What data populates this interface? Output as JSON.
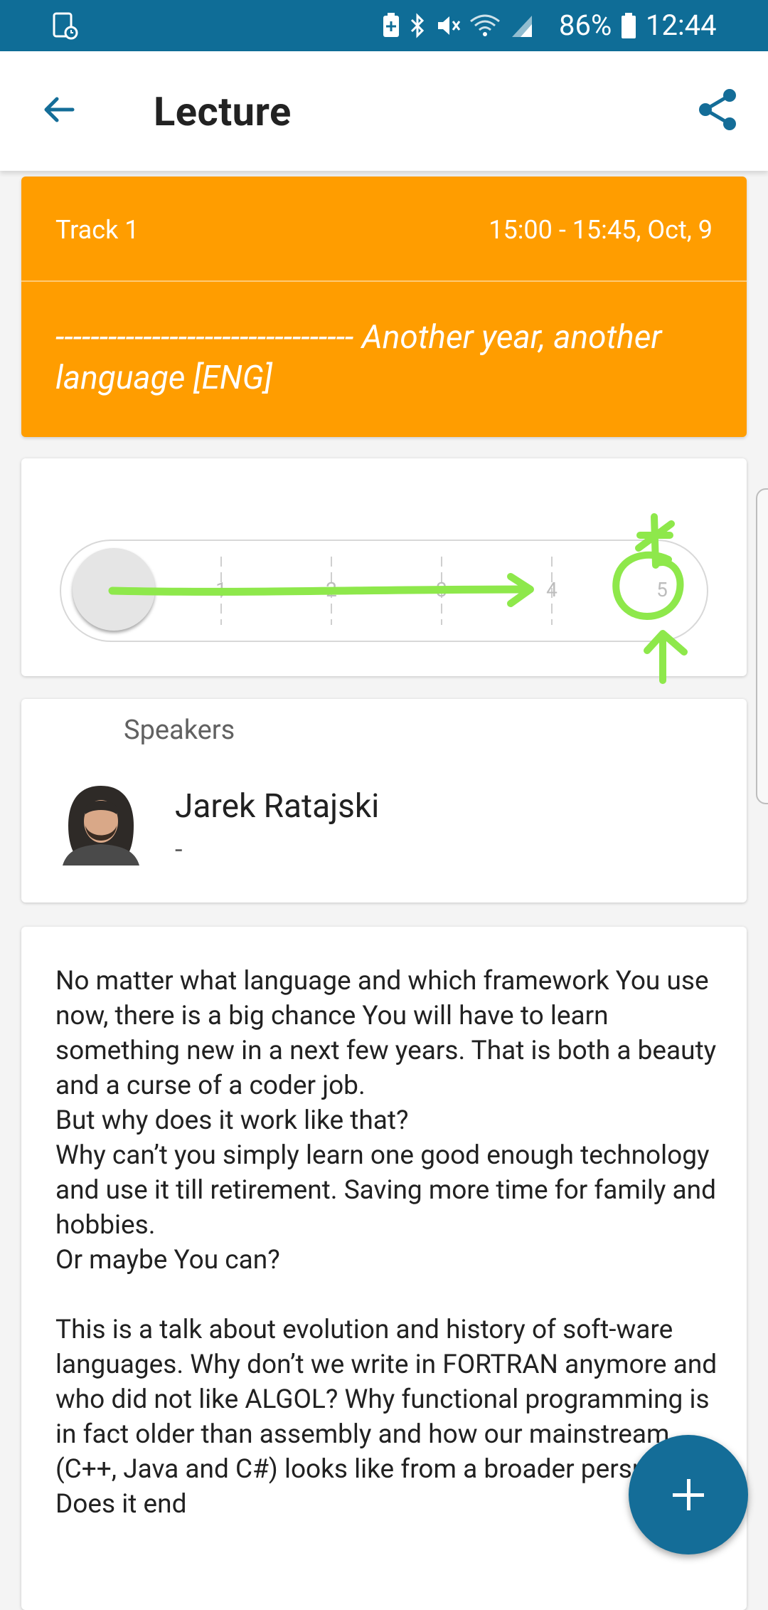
{
  "status_bar": {
    "battery_percent": "86%",
    "time": "12:44",
    "icons": [
      "screenshot-icon",
      "battery-saver-icon",
      "bluetooth-icon",
      "mute-icon",
      "wifi-icon",
      "signal-icon",
      "battery-icon"
    ]
  },
  "app_bar": {
    "title": "Lecture",
    "back_icon": "arrow-back-icon",
    "share_icon": "share-icon"
  },
  "track_card": {
    "track": "Track 1",
    "time": "15:00 - 15:45, Oct, 9",
    "dashes": "----------------------------------",
    "title": "Another year, another language [ENG]",
    "color": "#ff9d00"
  },
  "rating": {
    "labels": [
      "1",
      "2",
      "3",
      "4",
      "5"
    ],
    "annotation_color": "#8ee84b"
  },
  "speakers": {
    "heading": "Speakers",
    "items": [
      {
        "name": "Jarek Ratajski",
        "role": "-"
      }
    ]
  },
  "description": {
    "paragraphs": [
      "No matter what language and which framework You use now, there is a big chance You will have to learn something new in a next few years. That is both a beauty and a curse of a coder job.",
      "But why does it work like that?\nWhy can’t you simply learn one good enough technology and use it till retirement. Saving more time for family and hobbies.",
      "Or maybe You can?",
      "This is a talk about evolution and history of soft-ware languages. Why don’t we write in FORTRAN anymore and who did not like ALGOL? Why functional programming is in fact older than assembly and how our mainstream (C++, Java and C#) looks like from a broader perspective. Does it end"
    ]
  },
  "fab": {
    "icon": "plus-icon",
    "color": "#146d98"
  }
}
